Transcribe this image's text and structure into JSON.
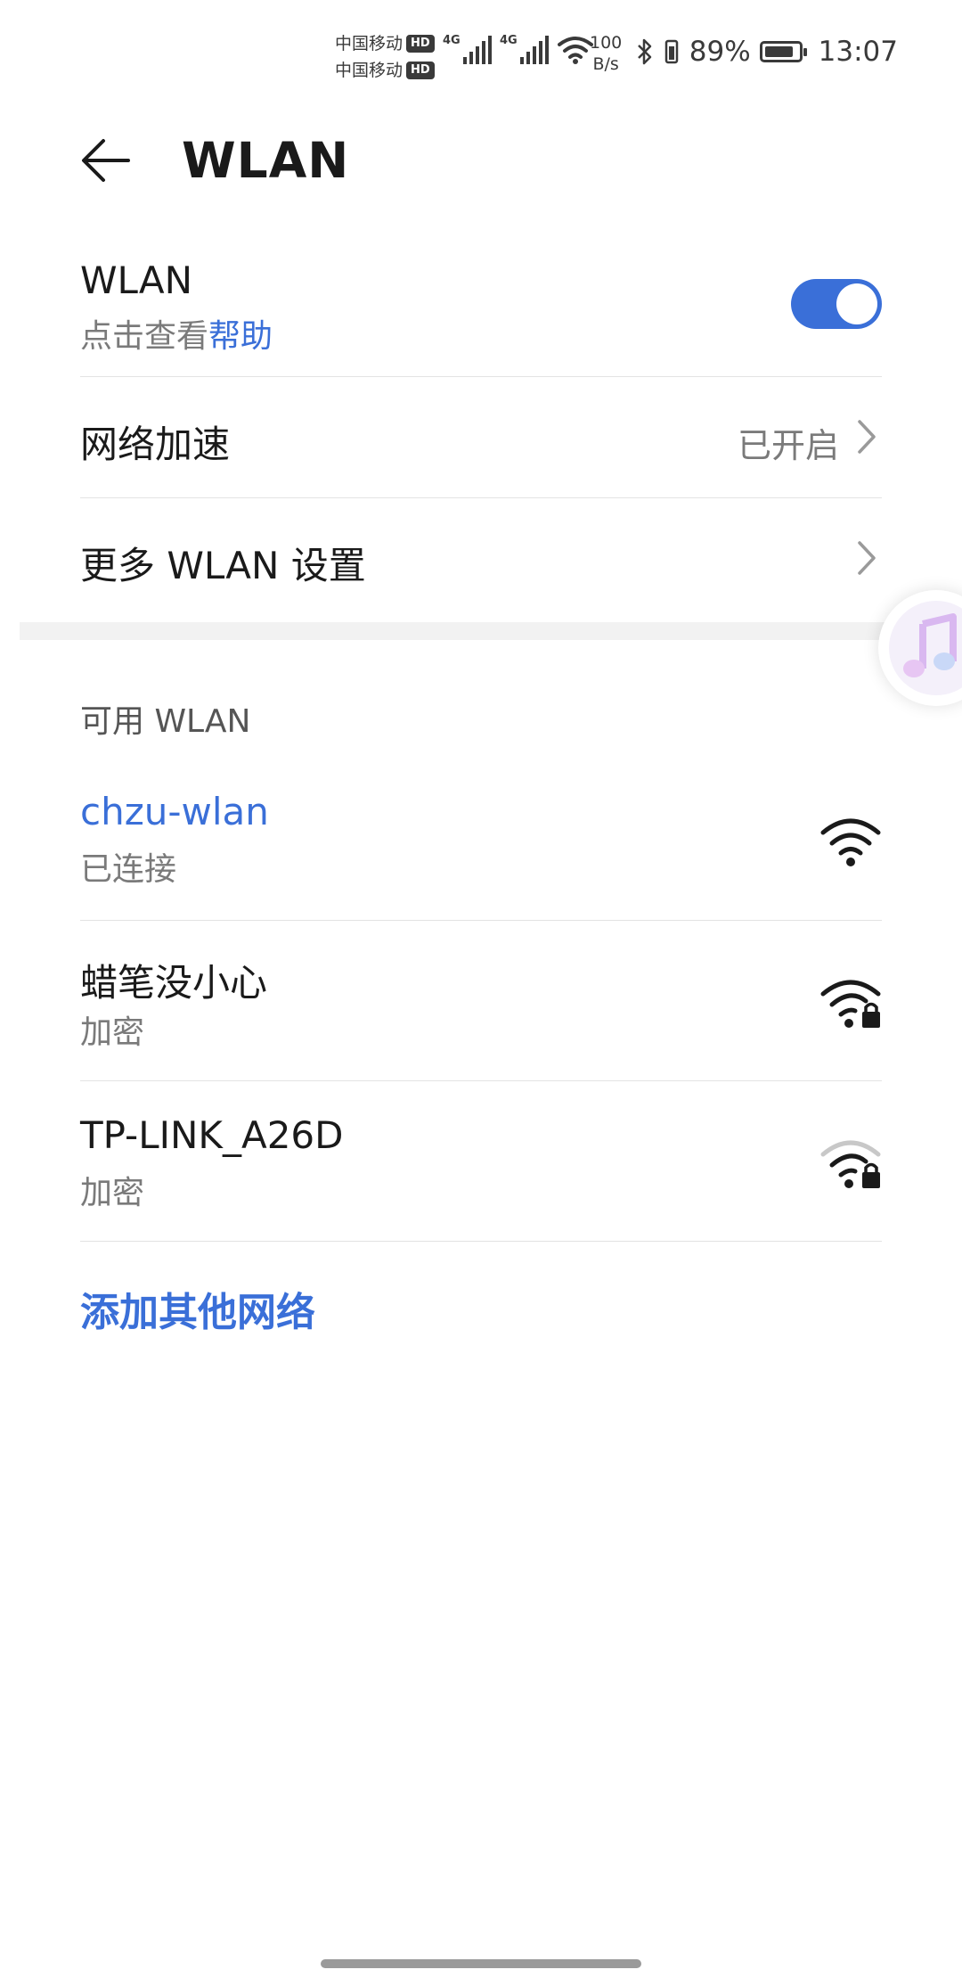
{
  "status_bar": {
    "carrier_1": "中国移动",
    "carrier_2": "中国移动",
    "hd_label": "HD",
    "network_1": "4G",
    "network_2": "4G",
    "speed_value": "100",
    "speed_unit": "B/s",
    "battery_percent": "89%",
    "battery_level": 0.89,
    "time": "13:07"
  },
  "header": {
    "title": "WLAN",
    "back_icon": "arrow-left-icon"
  },
  "wlan_toggle": {
    "label": "WLAN",
    "help_prefix": "点击查看",
    "help_link": "帮助",
    "enabled": true
  },
  "network_accel": {
    "label": "网络加速",
    "value": "已开启"
  },
  "more_settings": {
    "label": "更多 WLAN 设置"
  },
  "available": {
    "header": "可用 WLAN",
    "networks": [
      {
        "ssid": "chzu-wlan",
        "status": "已连接",
        "icon": "wifi-full-icon"
      },
      {
        "ssid": "蜡笔没小心",
        "status": "加密",
        "icon": "wifi-full-lock-icon"
      },
      {
        "ssid": "TP-LINK_A26D",
        "status": "加密",
        "icon": "wifi-weak-lock-icon"
      }
    ]
  },
  "add_network": {
    "label": "添加其他网络"
  },
  "colors": {
    "accent": "#3a6fd8",
    "text_primary": "#1a1a1a",
    "text_secondary": "#7a7a7a"
  }
}
